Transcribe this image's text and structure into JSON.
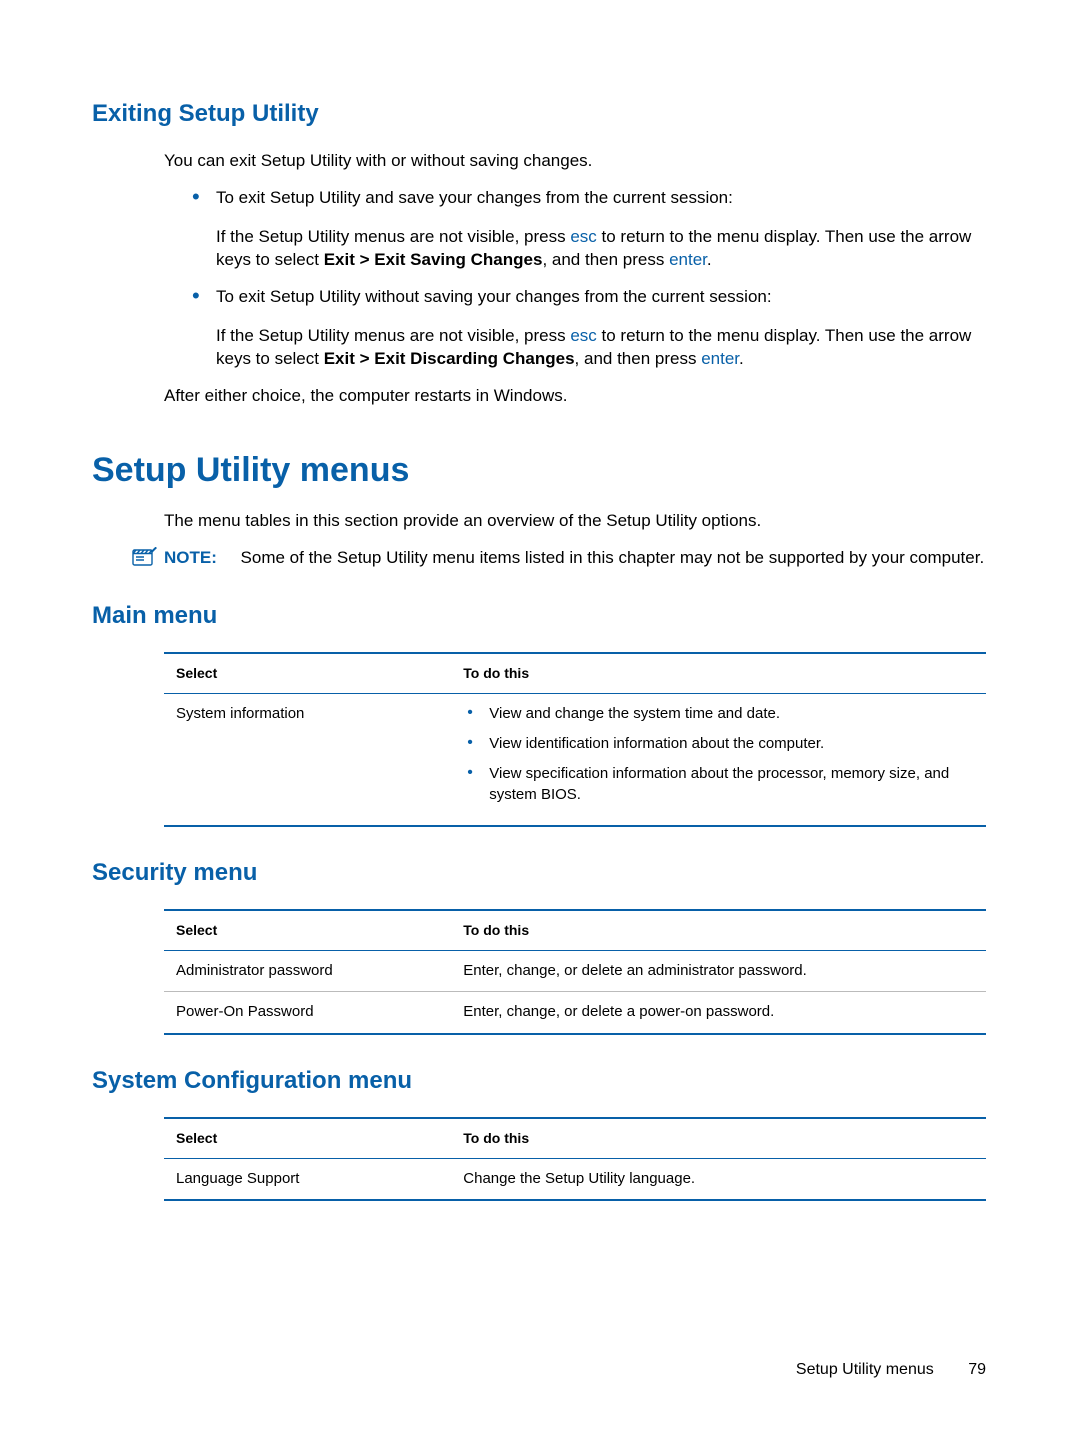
{
  "headings": {
    "exiting": "Exiting Setup Utility",
    "setup_menus": "Setup Utility menus",
    "main_menu": "Main menu",
    "security_menu": "Security menu",
    "sysconfig_menu": "System Configuration menu"
  },
  "exiting": {
    "intro": "You can exit Setup Utility with or without saving changes.",
    "b1_lead": "To exit Setup Utility and save your changes from the current session:",
    "b1_p_pre": "If the Setup Utility menus are not visible, press ",
    "b1_p_key": "esc",
    "b1_p_mid": " to return to the menu display. Then use the arrow keys to select ",
    "b1_p_bold": "Exit > Exit Saving Changes",
    "b1_p_post1": ", and then press ",
    "b1_p_key2": "enter",
    "b1_p_end": ".",
    "b2_lead": "To exit Setup Utility without saving your changes from the current session:",
    "b2_p_pre": "If the Setup Utility menus are not visible, press ",
    "b2_p_key": "esc",
    "b2_p_mid": " to return to the menu display. Then use the arrow keys to select ",
    "b2_p_bold": "Exit > Exit Discarding Changes",
    "b2_p_post1": ", and then press ",
    "b2_p_key2": "enter",
    "b2_p_end": ".",
    "after": "After either choice, the computer restarts in Windows."
  },
  "menus_intro": "The menu tables in this section provide an overview of the Setup Utility options.",
  "note": {
    "label": "NOTE:",
    "text": "Some of the Setup Utility menu items listed in this chapter may not be supported by your computer."
  },
  "table_headers": {
    "select": "Select",
    "todo": "To do this"
  },
  "main_table": {
    "r1_select": "System information",
    "r1_items": {
      "a": "View and change the system time and date.",
      "b": "View identification information about the computer.",
      "c": "View specification information about the processor, memory size, and system BIOS."
    }
  },
  "security_table": {
    "r1_select": "Administrator password",
    "r1_todo": "Enter, change, or delete an administrator password.",
    "r2_select": "Power-On Password",
    "r2_todo": "Enter, change, or delete a power-on password."
  },
  "sysconfig_table": {
    "r1_select": "Language Support",
    "r1_todo": "Change the Setup Utility language."
  },
  "footer": {
    "section": "Setup Utility menus",
    "page": "79"
  }
}
